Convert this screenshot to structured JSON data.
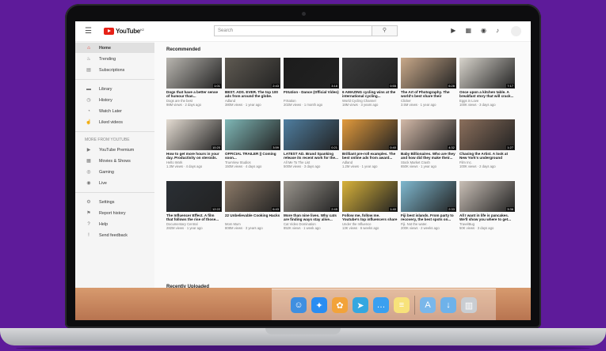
{
  "header": {
    "logo_text": "YouTube",
    "logo_sup": "KZ",
    "search_placeholder": "Search"
  },
  "sidebar": {
    "main_items": [
      {
        "label": "Home",
        "icon": "home-icon",
        "active": true
      },
      {
        "label": "Trending",
        "icon": "flame-icon"
      },
      {
        "label": "Subscriptions",
        "icon": "subscriptions-icon"
      }
    ],
    "library_items": [
      {
        "label": "Library",
        "icon": "folder-icon"
      },
      {
        "label": "History",
        "icon": "history-icon"
      },
      {
        "label": "Watch Later",
        "icon": "clock-icon"
      },
      {
        "label": "Liked videos",
        "icon": "thumbs-up-icon"
      }
    ],
    "more_heading": "MORE FROM YOUTUBE",
    "more_items": [
      {
        "label": "YouTube Premium",
        "icon": "youtube-icon"
      },
      {
        "label": "Movies & Shows",
        "icon": "film-icon"
      },
      {
        "label": "Gaming",
        "icon": "gamepad-icon"
      },
      {
        "label": "Live",
        "icon": "live-icon"
      }
    ],
    "settings_items": [
      {
        "label": "Settings",
        "icon": "gear-icon"
      },
      {
        "label": "Report history",
        "icon": "flag-icon"
      },
      {
        "label": "Help",
        "icon": "help-icon"
      },
      {
        "label": "Send feedback",
        "icon": "feedback-icon"
      }
    ]
  },
  "recommended_title": "Recommended",
  "recently_uploaded_title": "Recently Uploaded",
  "videos": [
    {
      "title": "Dogs that have a better sense of humour than...",
      "channel": "Dogs are the best",
      "meta": "98M views · 2 days ago",
      "duration": "1:01",
      "color": "#b9b6b0"
    },
    {
      "title": "BEST. ADS. EVER. The top 100 ads from around the globe.",
      "channel": "Adland",
      "meta": "380M views · 1 year ago",
      "duration": "2:43",
      "color": "#5f5a52"
    },
    {
      "title": "FIXation - Dance (Official Video)",
      "channel": "FIXation",
      "meta": "202M views · 1 month ago",
      "duration": "3:18",
      "color": "#1c1c1c"
    },
    {
      "title": "6 AMAZING cycling wins at the international cycling...",
      "channel": "World Cycling Channel",
      "meta": "18M views · 3 years ago",
      "duration": "0:55",
      "color": "#3b3b3b"
    },
    {
      "title": "The Art of Photography. The world's best share their secrets.",
      "channel": "Clicker",
      "meta": "3.5M views · 1 year ago",
      "duration": "6:28",
      "color": "#c9a98a"
    },
    {
      "title": "Once upon a kitchen table. A breakfast story that will crack...",
      "channel": "Eggs in Love",
      "meta": "100K views · 3 days ago",
      "duration": "7:17",
      "color": "#d8d4cc"
    },
    {
      "title": "How to get more hours in your day. Productivity on steroids.",
      "channel": "Hello Work",
      "meta": "1.3M views · 4 days ago",
      "duration": "10:20",
      "color": "#e4dcd2"
    },
    {
      "title": "OFFICIAL TRAILER || Coming soon...",
      "channel": "TrueView Studios",
      "meta": "150M views · 4 days ago",
      "duration": "3:59",
      "color": "#7fb7b6"
    },
    {
      "title": "LATEST AD. Brand Spanking release its recent work for the...",
      "channel": "All Me To The List",
      "meta": "500M views · 3 days ago",
      "duration": "0:21",
      "color": "#4f7ea0"
    },
    {
      "title": "Brilliant pre-roll examples. The best online ads from award...",
      "channel": "Adland",
      "meta": "1.2M views · 1 year ago",
      "duration": "0:40",
      "color": "#e29a3c"
    },
    {
      "title": "Baby Billionaires. Who are they and how did they make their...",
      "channel": "Stock Market Crash",
      "meta": "650K views · 1 year ago",
      "duration": "4:32",
      "color": "#d3b9a8"
    },
    {
      "title": "Chasing the Artist. A look at New York's underground graffiti...",
      "channel": "Film Inc.",
      "meta": "100K views · 2 days ago",
      "duration": "1:27",
      "color": "#8b6f5c"
    },
    {
      "title": "The Influencer Effect. A film that follows the rise of those...",
      "channel": "Documentary Central",
      "meta": "282M views · 1 year ago",
      "duration": "12:22",
      "color": "#2a2f35"
    },
    {
      "title": "22 Unbelievable Cooking Hacks",
      "channel": "Mom Mum",
      "meta": "808M views · 3 years ago",
      "duration": "6:43",
      "color": "#8c7a68"
    },
    {
      "title": "More than nine lives. Why cats are finding ways stay alive...",
      "channel": "Cat Video Domination",
      "meta": "852K views · 1 week ago",
      "duration": "2:45",
      "color": "#9a958d"
    },
    {
      "title": "Follow me, follow me. Youtube's top influencers share their...",
      "channel": "Under the Influence",
      "meta": "13K views · 6 weeks ago",
      "duration": "1:40",
      "color": "#d8b23a"
    },
    {
      "title": "Fiji best islands. From party to recovery, the best spots on...",
      "channel": "Fiji. Not the water.",
      "meta": "200K views · 2 weeks ago",
      "duration": "2:33",
      "color": "#7fb8cf"
    },
    {
      "title": "All I want in life is pancakes. We'll show you where to get...",
      "channel": "TravelBug",
      "meta": "50K views · 3 days ago",
      "duration": "3:36",
      "color": "#c9bfb6"
    }
  ],
  "thin_row_colors": [
    "#6fa4c8",
    "#4d4a47",
    "#b4aca2",
    "#f0b76b",
    "#c6c1b8",
    "#d8c7b5"
  ],
  "dock": {
    "icons": [
      {
        "name": "finder-icon",
        "color": "#3f8fe0",
        "glyph": "☺"
      },
      {
        "name": "safari-icon",
        "color": "#2a8df2",
        "glyph": "✦"
      },
      {
        "name": "owl-app-icon",
        "color": "#f2a33a",
        "glyph": "✿"
      },
      {
        "name": "telegram-icon",
        "color": "#34a7e0",
        "glyph": "➤"
      },
      {
        "name": "messages-icon",
        "color": "#3aa0f0",
        "glyph": "…"
      },
      {
        "name": "notes-icon",
        "color": "#f7e27a",
        "glyph": "≡"
      },
      {
        "name": "applications-folder-icon",
        "color": "#7ab7ea",
        "glyph": "A"
      },
      {
        "name": "downloads-folder-icon",
        "color": "#6eb2ea",
        "glyph": "↓"
      },
      {
        "name": "trash-icon",
        "color": "#c9cdd2",
        "glyph": "▥"
      }
    ]
  }
}
